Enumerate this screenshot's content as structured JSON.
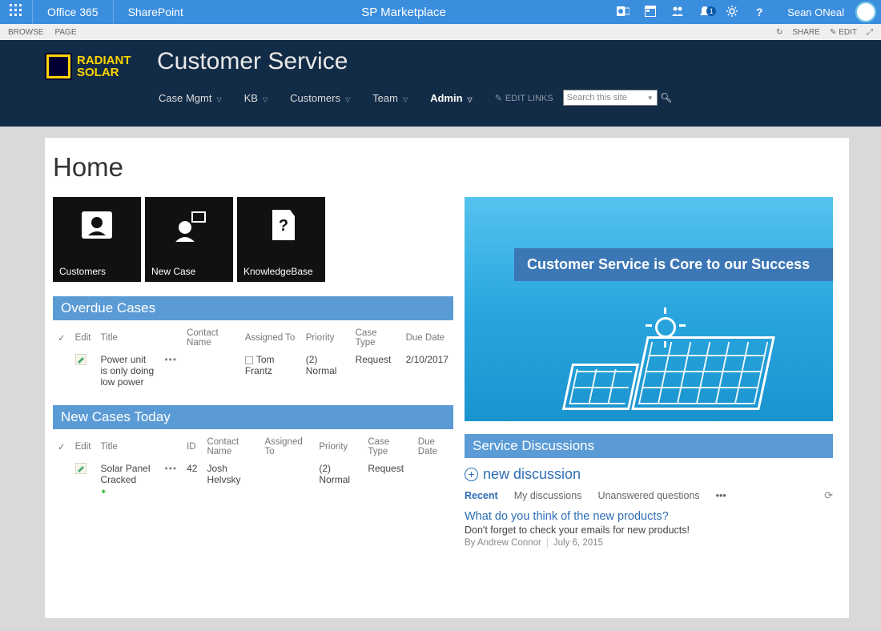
{
  "suite": {
    "waffle_icon": "waffle",
    "brand1": "Office 365",
    "brand2": "SharePoint",
    "center_title": "SP Marketplace",
    "icons": [
      "outlook",
      "calendar",
      "people",
      "bell",
      "gear",
      "help"
    ],
    "notification_count": "1",
    "user_name": "Sean ONeal"
  },
  "ribbon": {
    "tabs": [
      "BROWSE",
      "PAGE"
    ],
    "actions": [
      {
        "icon": "↻",
        "label": ""
      },
      {
        "icon": "",
        "label": "SHARE"
      },
      {
        "icon": "✎",
        "label": "EDIT"
      },
      {
        "icon": "⤢",
        "label": ""
      }
    ]
  },
  "masthead": {
    "logo_line1": "RADIANT",
    "logo_line2": "SOLAR",
    "site_title": "Customer Service",
    "nav": [
      {
        "label": "Case Mgmt",
        "dd": true
      },
      {
        "label": "KB",
        "dd": true
      },
      {
        "label": "Customers",
        "dd": true
      },
      {
        "label": "Team",
        "dd": true
      },
      {
        "label": "Admin",
        "dd": true,
        "active": true
      }
    ],
    "edit_links": "EDIT LINKS",
    "search_placeholder": "Search this site"
  },
  "page_title": "Home",
  "tiles": [
    {
      "label": "Customers"
    },
    {
      "label": "New Case"
    },
    {
      "label": "KnowledgeBase"
    }
  ],
  "overdue": {
    "heading": "Overdue Cases",
    "cols": [
      "",
      "Edit",
      "Title",
      "",
      "Contact Name",
      "Assigned To",
      "Priority",
      "Case Type",
      "Due Date"
    ],
    "rows": [
      {
        "edit": "",
        "title": "Power unit is only doing low power",
        "contact": "",
        "assigned": "Tom Frantz",
        "priority": "(2) Normal",
        "casetype": "Request",
        "due": "2/10/2017"
      }
    ]
  },
  "newcases": {
    "heading": "New Cases Today",
    "cols": [
      "",
      "Edit",
      "Title",
      "",
      "ID",
      "Contact Name",
      "Assigned To",
      "Priority",
      "Case Type",
      "Due Date"
    ],
    "rows": [
      {
        "edit": "",
        "title": "Solar Panel Cracked",
        "id": "42",
        "contact": "Josh Helvsky",
        "assigned": "",
        "priority": "(2) Normal",
        "casetype": "Request",
        "due": "",
        "new": true
      }
    ]
  },
  "hero": {
    "strap": "Customer Service is Core to our Success"
  },
  "discussions": {
    "heading": "Service Discussions",
    "new_label": "new discussion",
    "tabs": [
      "Recent",
      "My discussions",
      "Unanswered questions"
    ],
    "thread": {
      "q": "What do you think of the new products?",
      "sub": "Don't forget to check your emails for new products!",
      "by_prefix": "By ",
      "author": "Andrew Connor",
      "date": "July 6, 2015"
    }
  }
}
